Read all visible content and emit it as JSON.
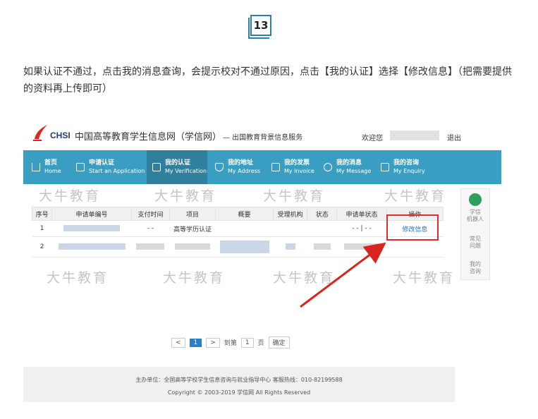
{
  "step": {
    "number": "13"
  },
  "instruction": "如果认证不通过，点击我的消息查询，会提示校对不通过原因，点击【我的认证】选择【修改信息】（把需要提供的资料再上传即可）",
  "header": {
    "logo_text": "CHSI",
    "site_title": "中国高等教育学生信息网（学信网）",
    "site_subtitle": "— 出国教育背景信息服务",
    "welcome": "欢迎您",
    "logout": "退出"
  },
  "nav": [
    {
      "cn": "首页",
      "en": "Home"
    },
    {
      "cn": "申请认证",
      "en": "Start an Application"
    },
    {
      "cn": "我的认证",
      "en": "My Verification"
    },
    {
      "cn": "我的地址",
      "en": "My Address"
    },
    {
      "cn": "我的发票",
      "en": "My Invoice"
    },
    {
      "cn": "我的消息",
      "en": "My Message"
    },
    {
      "cn": "我的咨询",
      "en": "My Enquiry"
    }
  ],
  "table": {
    "headers": [
      "序号",
      "申请单编号",
      "支付时间",
      "项目",
      "概要",
      "受理机构",
      "状态",
      "申请单状态",
      "操作"
    ],
    "rows": [
      {
        "index": "1",
        "pay_time": "- -",
        "item": "高等学历认证",
        "order_status": "- - | - -",
        "action": "修改信息"
      },
      {
        "index": "2"
      }
    ]
  },
  "pager": {
    "current": "1",
    "goto_label": "到第",
    "goto_value": "1",
    "page_suffix": "页",
    "confirm": "确定"
  },
  "sidebar": {
    "robot_label": "学信\n机器人",
    "faq": "常见\n问题",
    "my_enquiry": "我的\n咨询"
  },
  "watermark": "大牛教育",
  "footer": {
    "line1": "主办单位：全国高等学校学生信息咨询与就业指导中心    客服热线：010-82199588",
    "line2": "Copyright © 2003-2019 学信网 All Rights Reserved"
  },
  "colors": {
    "nav_bg": "#3a9ec2",
    "nav_active": "#2f7f9d",
    "highlight": "#e52a2a",
    "link": "#2a6fc0"
  }
}
